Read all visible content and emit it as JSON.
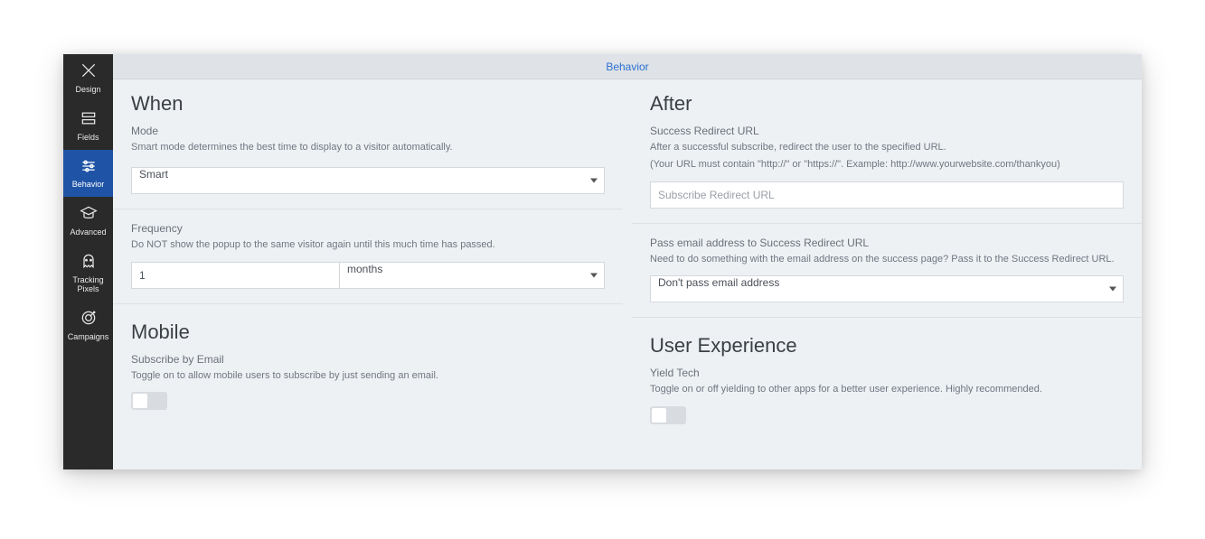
{
  "sidebar": {
    "items": [
      {
        "label": "Design"
      },
      {
        "label": "Fields"
      },
      {
        "label": "Behavior"
      },
      {
        "label": "Advanced"
      },
      {
        "label": "Tracking Pixels"
      },
      {
        "label": "Campaigns"
      }
    ]
  },
  "topbar": {
    "title": "Behavior"
  },
  "when": {
    "heading": "When",
    "mode_label": "Mode",
    "mode_help": "Smart mode determines the best time to display to a visitor automatically.",
    "mode_value": "Smart",
    "freq_label": "Frequency",
    "freq_help": "Do NOT show the popup to the same visitor again until this much time has passed.",
    "freq_value": "1",
    "freq_unit": "months"
  },
  "mobile": {
    "heading": "Mobile",
    "subscribe_label": "Subscribe by Email",
    "subscribe_help": "Toggle on to allow mobile users to subscribe by just sending an email."
  },
  "after": {
    "heading": "After",
    "redirect_label": "Success Redirect URL",
    "redirect_help1": "After a successful subscribe, redirect the user to the specified URL.",
    "redirect_help2": "(Your URL must contain \"http://\" or \"https://\". Example: http://www.yourwebsite.com/thankyou)",
    "redirect_placeholder": "Subscribe Redirect URL",
    "pass_label": "Pass email address to Success Redirect URL",
    "pass_help": "Need to do something with the email address on the success page? Pass it to the Success Redirect URL.",
    "pass_value": "Don't pass email address"
  },
  "ux": {
    "heading": "User Experience",
    "yield_label": "Yield Tech",
    "yield_help": "Toggle on or off yielding to other apps for a better user experience. Highly recommended."
  }
}
